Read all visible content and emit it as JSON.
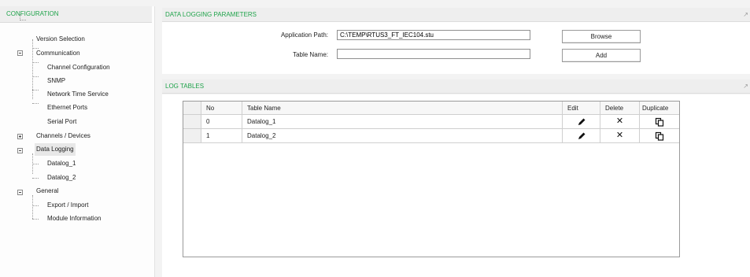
{
  "sidebar": {
    "title": "CONFIGURATION",
    "items": [
      {
        "label": "Version Selection"
      },
      {
        "label": "Communication"
      },
      {
        "label": "Channel Configuration"
      },
      {
        "label": "SNMP"
      },
      {
        "label": "Network Time Service"
      },
      {
        "label": "Ethernet Ports"
      },
      {
        "label": "Serial Port"
      },
      {
        "label": "Channels / Devices"
      },
      {
        "label": "Data Logging"
      },
      {
        "label": "Datalog_1"
      },
      {
        "label": "Datalog_2"
      },
      {
        "label": "General"
      },
      {
        "label": "Export / Import"
      },
      {
        "label": "Module Information"
      }
    ]
  },
  "params": {
    "title": "DATA LOGGING PARAMETERS",
    "app_path_label": "Application Path:",
    "app_path_value": "C:\\TEMP\\RTUS3_FT_IEC104.stu",
    "table_name_label": "Table Name:",
    "table_name_value": "",
    "browse_label": "Browse",
    "add_label": "Add"
  },
  "log_tables": {
    "title": "LOG TABLES",
    "columns": {
      "no": "No",
      "name": "Table Name",
      "edit": "Edit",
      "delete": "Delete",
      "duplicate": "Duplicate"
    },
    "rows": [
      {
        "no": "0",
        "name": "Datalog_1"
      },
      {
        "no": "1",
        "name": "Datalog_2"
      }
    ],
    "icons": {
      "edit": "pencil-icon",
      "delete": "delete-x-icon",
      "duplicate": "duplicate-icon"
    }
  }
}
